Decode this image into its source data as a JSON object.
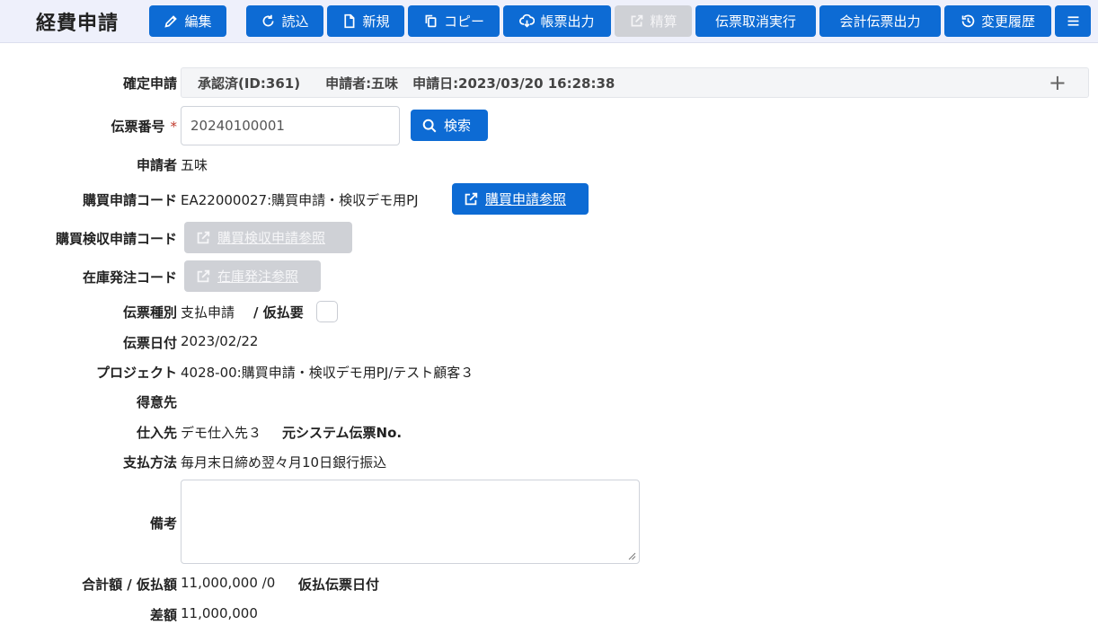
{
  "header": {
    "title": "経費申請",
    "buttons": {
      "edit": "編集",
      "load": "読込",
      "new": "新規",
      "copy": "コピー",
      "export": "帳票出力",
      "settle": "精算",
      "cancel_slip": "伝票取消実行",
      "accounting": "会計伝票出力",
      "history": "変更履歴"
    }
  },
  "form": {
    "confirm": {
      "label": "確定申請",
      "status": "承認済(ID:361)",
      "applicant": "申請者:五味",
      "date": "申請日:2023/03/20 16:28:38",
      "expand": "+"
    },
    "slip_no": {
      "label": "伝票番号",
      "required_mark": "*",
      "value": "20240100001",
      "search": "検索"
    },
    "applicant": {
      "label": "申請者",
      "value": "五味"
    },
    "purchase_code": {
      "label": "購買申請コード",
      "value": "EA22000027:購買申請・検収デモ用PJ",
      "button": "購買申請参照"
    },
    "inspection_code": {
      "label": "購買検収申請コード",
      "button": "購買検収申請参照"
    },
    "stock_order_code": {
      "label": "在庫発注コード",
      "button": "在庫発注参照"
    },
    "slip_type": {
      "label": "伝票種別",
      "value": "支払申請",
      "advance_label": "/ 仮払要"
    },
    "slip_date": {
      "label": "伝票日付",
      "value": "2023/02/22"
    },
    "project": {
      "label": "プロジェクト",
      "value": "4028-00:購買申請・検収デモ用PJ/テスト顧客３"
    },
    "customer": {
      "label": "得意先"
    },
    "supplier": {
      "label": "仕入先",
      "value": "デモ仕入先３",
      "origin_label": "元システム伝票No."
    },
    "payment": {
      "label": "支払方法",
      "value": "毎月末日締め翌々月10日銀行振込"
    },
    "remarks": {
      "label": "備考"
    },
    "total": {
      "label": "合計額 / 仮払額",
      "value": "11,000,000 /0",
      "advance_date_label": "仮払伝票日付"
    },
    "diff": {
      "label": "差額",
      "value": "11,000,000"
    }
  },
  "colors": {
    "primary": "#0d6bd4",
    "disabled": "#cfd1d6",
    "header_bg": "#eef0fb"
  }
}
